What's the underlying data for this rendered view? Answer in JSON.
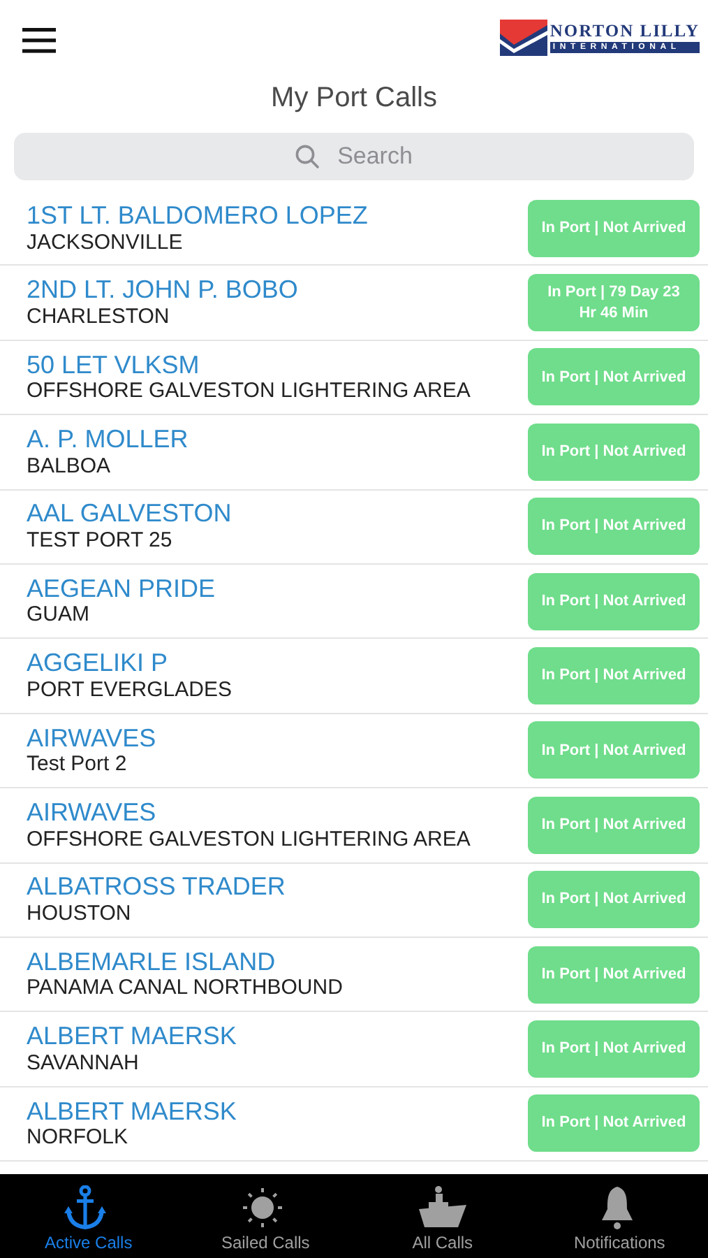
{
  "header": {
    "logo": {
      "name": "NORTON LILLY",
      "subtitle": "INTERNATIONAL"
    },
    "title": "My Port Calls"
  },
  "search": {
    "placeholder": "Search"
  },
  "calls": [
    {
      "vessel": "1ST LT. BALDOMERO LOPEZ",
      "port": "JACKSONVILLE",
      "status": "In Port | Not Arrived"
    },
    {
      "vessel": "2ND LT. JOHN P. BOBO",
      "port": "CHARLESTON",
      "status": "In Port | 79 Day 23 Hr 46 Min"
    },
    {
      "vessel": "50 LET VLKSM",
      "port": "OFFSHORE GALVESTON LIGHTERING AREA",
      "status": "In Port | Not Arrived"
    },
    {
      "vessel": "A. P. MOLLER",
      "port": "BALBOA",
      "status": "In Port | Not Arrived"
    },
    {
      "vessel": "AAL GALVESTON",
      "port": "TEST PORT 25",
      "status": "In Port | Not Arrived"
    },
    {
      "vessel": "AEGEAN PRIDE",
      "port": "GUAM",
      "status": "In Port | Not Arrived"
    },
    {
      "vessel": "AGGELIKI P",
      "port": "PORT EVERGLADES",
      "status": "In Port | Not Arrived"
    },
    {
      "vessel": "AIRWAVES",
      "port": "Test Port 2",
      "status": "In Port | Not Arrived"
    },
    {
      "vessel": "AIRWAVES",
      "port": "OFFSHORE GALVESTON LIGHTERING AREA",
      "status": "In Port | Not Arrived"
    },
    {
      "vessel": "ALBATROSS TRADER",
      "port": "HOUSTON",
      "status": "In Port | Not Arrived"
    },
    {
      "vessel": "ALBEMARLE ISLAND",
      "port": "PANAMA CANAL NORTHBOUND",
      "status": "In Port | Not Arrived"
    },
    {
      "vessel": "ALBERT MAERSK",
      "port": "SAVANNAH",
      "status": "In Port | Not Arrived"
    },
    {
      "vessel": "ALBERT MAERSK",
      "port": "NORFOLK",
      "status": "In Port | Not Arrived"
    }
  ],
  "tabs": [
    {
      "label": "Active Calls",
      "kind": "anchor",
      "selected": true
    },
    {
      "label": "Sailed Calls",
      "kind": "sun",
      "selected": false
    },
    {
      "label": "All Calls",
      "kind": "ship",
      "selected": false
    },
    {
      "label": "Notifications",
      "kind": "bell",
      "selected": false
    }
  ]
}
